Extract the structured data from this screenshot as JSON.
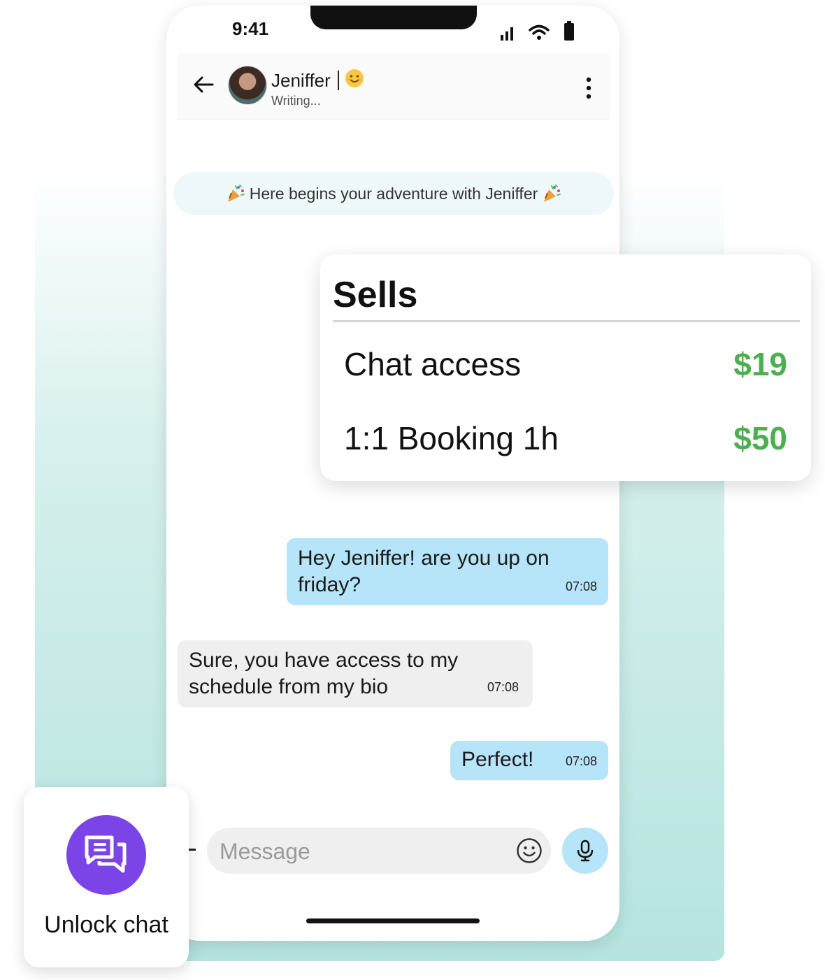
{
  "status_bar": {
    "time": "9:41"
  },
  "chat_header": {
    "contact_name": "Jeniffer",
    "status": "Writing..."
  },
  "banner": {
    "text": "Here begins your adventure with Jeniffer"
  },
  "messages": [
    {
      "direction": "outgoing",
      "text": "Hey Jeniffer! are you up on friday?",
      "time": "07:08"
    },
    {
      "direction": "incoming",
      "text": "Sure, you have access to my schedule from my bio",
      "time": "07:08"
    },
    {
      "direction": "outgoing",
      "text": "Perfect!",
      "time": "07:08"
    }
  ],
  "composer": {
    "placeholder": "Message"
  },
  "sells": {
    "title": "Sells",
    "items": [
      {
        "label": "Chat access",
        "price": "$19"
      },
      {
        "label": "1:1 Booking 1h",
        "price": "$50"
      }
    ]
  },
  "unlock": {
    "label": "Unlock chat"
  },
  "colors": {
    "accent_bubble": "#b6e4f8",
    "price_green": "#4caf50",
    "unlock_purple": "#7b44e6"
  },
  "icons": [
    "back-arrow-icon",
    "smiley-icon",
    "more-vertical-icon",
    "party-popper-icon",
    "emoji-smiley-icon",
    "microphone-icon",
    "chat-bubbles-icon",
    "signal-icon",
    "wifi-icon",
    "battery-icon"
  ]
}
